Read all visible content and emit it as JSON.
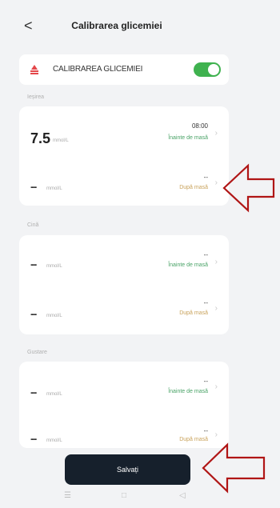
{
  "header": {
    "back_glyph": "<",
    "title": "Calibrarea glicemiei"
  },
  "toggle": {
    "label": "CALIBRAREA GLICEMIEI",
    "enabled": true
  },
  "sections": [
    {
      "label": "Ieșirea",
      "rows": [
        {
          "value": "7.5",
          "unit": "mmol/L",
          "time": "08:00",
          "meal": "Înainte de masă"
        },
        {
          "value": "--",
          "unit": "mmol/L",
          "time": "--",
          "meal": "După masă"
        }
      ]
    },
    {
      "label": "Cină",
      "rows": [
        {
          "value": "--",
          "unit": "mmol/L",
          "time": "--",
          "meal": "Înainte de masă"
        },
        {
          "value": "--",
          "unit": "mmol/L",
          "time": "--",
          "meal": "După masă"
        }
      ]
    },
    {
      "label": "Gustare",
      "rows": [
        {
          "value": "--",
          "unit": "mmol/L",
          "time": "--",
          "meal": "Înainte de masă"
        },
        {
          "value": "--",
          "unit": "mmol/L",
          "time": "--",
          "meal": "După masă"
        }
      ]
    }
  ],
  "save_label": "Salvați",
  "nav": {
    "menu": "☰",
    "home": "□",
    "back": "◁"
  },
  "colors": {
    "accent": "#3fb24f",
    "arrow": "#b01515",
    "button": "#16202c"
  }
}
